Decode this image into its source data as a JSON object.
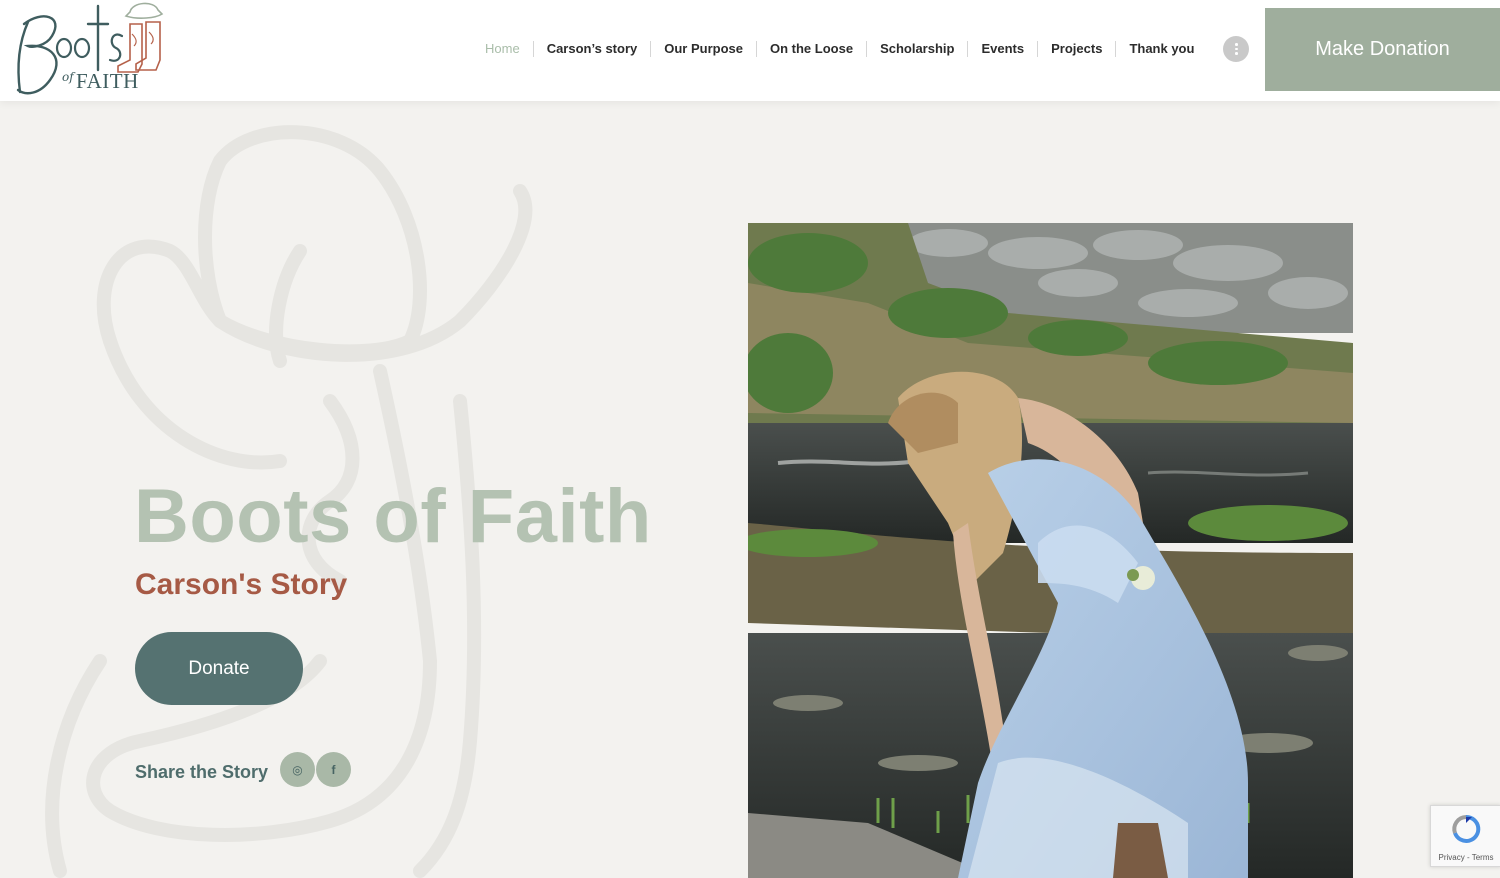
{
  "logo": {
    "alt": "Boots of Faith",
    "word": "FAITH",
    "of_text": "of"
  },
  "nav": {
    "items": [
      {
        "label": "Home",
        "active": true
      },
      {
        "label": "Carson’s story"
      },
      {
        "label": "Our Purpose"
      },
      {
        "label": "On the Loose"
      },
      {
        "label": "Scholarship"
      },
      {
        "label": "Events"
      },
      {
        "label": "Projects"
      },
      {
        "label": "Thank you"
      }
    ],
    "more_icon": "more-vertical-icon"
  },
  "header_cta": {
    "label": "Make Donation"
  },
  "hero": {
    "title": "Boots of Faith",
    "subtitle": "Carson's Story",
    "donate_label": "Donate",
    "share_label": "Share the Story",
    "social": [
      {
        "icon": "instagram-icon",
        "glyph": "◎"
      },
      {
        "icon": "facebook-icon",
        "glyph": "f"
      }
    ],
    "photo_icon": "hero-photo"
  },
  "recaptcha": {
    "text": "Privacy - Terms"
  },
  "colors": {
    "background": "#f3f2ef",
    "accent_sage": "#9fae9d",
    "title_sage": "#b4c2b2",
    "subtitle_rust": "#a65a45",
    "button_teal": "#557271",
    "nav_active": "#a9bda9"
  }
}
